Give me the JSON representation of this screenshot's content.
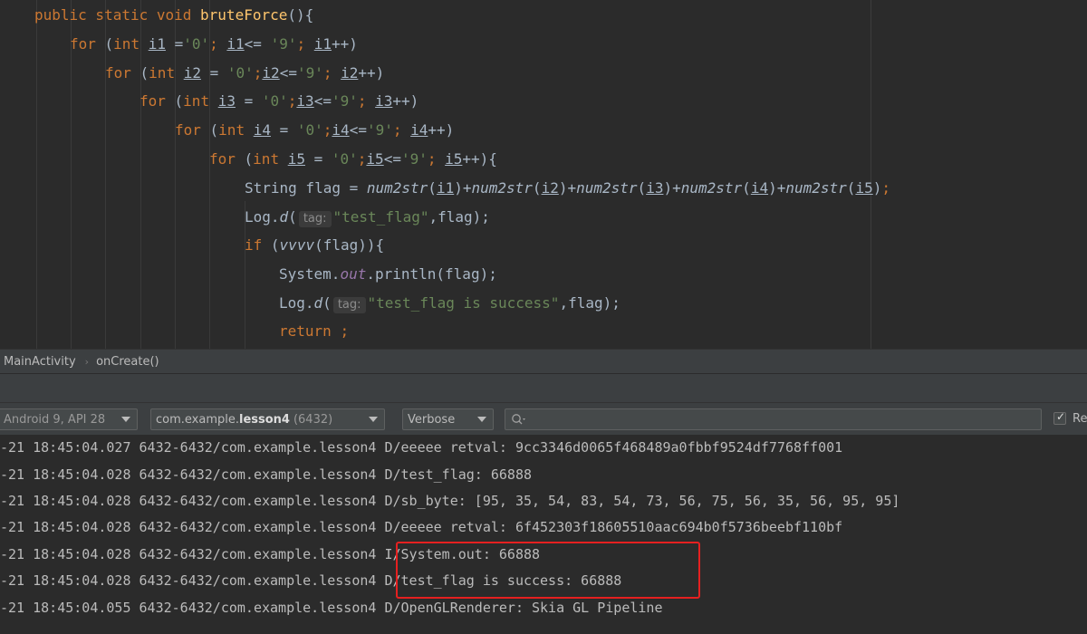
{
  "code": {
    "method_signature": {
      "mod": "public static void ",
      "name": "bruteForce",
      "rest": "(){"
    },
    "loop1": {
      "kw": "for ",
      "a": "(",
      "type": "int ",
      "var": "i1",
      "b": " =",
      "s1": "'0'",
      "c": "; ",
      "var2": "i1",
      "d": "<= ",
      "s2": "'9'",
      "e": "; ",
      "var3": "i1",
      "f": "++)"
    },
    "loop2": {
      "kw": "for ",
      "a": "(",
      "type": "int ",
      "var": "i2",
      "b": " = ",
      "s1": "'0'",
      "c": ";",
      "var2": "i2",
      "d": "<=",
      "s2": "'9'",
      "e": "; ",
      "var3": "i2",
      "f": "++)"
    },
    "loop3": {
      "kw": "for ",
      "a": "(",
      "type": "int ",
      "var": "i3",
      "b": " = ",
      "s1": "'0'",
      "c": ";",
      "var2": "i3",
      "d": "<=",
      "s2": "'9'",
      "e": "; ",
      "var3": "i3",
      "f": "++)"
    },
    "loop4": {
      "kw": "for ",
      "a": "(",
      "type": "int ",
      "var": "i4",
      "b": " = ",
      "s1": "'0'",
      "c": ";",
      "var2": "i4",
      "d": "<=",
      "s2": "'9'",
      "e": "; ",
      "var3": "i4",
      "f": "++)"
    },
    "loop5": {
      "kw": "for ",
      "a": "(",
      "type": "int ",
      "var": "i5",
      "b": " = ",
      "s1": "'0'",
      "c": ";",
      "var2": "i5",
      "d": "<=",
      "s2": "'9'",
      "e": "; ",
      "var3": "i5",
      "f": "++){"
    },
    "flag_line": {
      "type": "String flag = ",
      "fn": "num2str",
      "v1": "i1",
      "v2": "i2",
      "v3": "i3",
      "v4": "i4",
      "v5": "i5",
      "plus": "+",
      "open": "(",
      "close": ")",
      "semi": ";"
    },
    "logd1": {
      "obj": "Log.",
      "method": "d",
      "open": "(",
      "hint": "tag:",
      "str": "\"test_flag\"",
      "rest": ",flag);"
    },
    "if_line": {
      "kw": "if ",
      "open": "(",
      "fn": "vvvv",
      "rest": "(flag)){"
    },
    "println": {
      "obj": "System.",
      "field": "out",
      "rest": ".println(flag);"
    },
    "logd2": {
      "obj": "Log.",
      "method": "d",
      "open": "(",
      "hint": "tag:",
      "str": "\"test_flag is success\"",
      "rest": ",flag);"
    },
    "return_line": {
      "kw": "return ",
      "rest": ";"
    }
  },
  "breadcrumb": {
    "class_name": "MainActivity",
    "separator": "›",
    "method_name": "onCreate()"
  },
  "filters": {
    "device": "Android 9, API 28",
    "process_prefix": "com.example.",
    "process_bold": "lesson4",
    "process_pid": "(6432)",
    "log_level": "Verbose",
    "search_value": "",
    "regex_checked": true,
    "regex_label": "Re"
  },
  "logcat": {
    "lines": [
      "-21 18:45:04.027 6432-6432/com.example.lesson4 D/eeeee retval: 9cc3346d0065f468489a0fbbf9524df7768ff001",
      "-21 18:45:04.028 6432-6432/com.example.lesson4 D/test_flag: 66888",
      "-21 18:45:04.028 6432-6432/com.example.lesson4 D/sb_byte: [95, 35, 54, 83, 54, 73, 56, 75, 56, 35, 56, 95, 95]",
      "-21 18:45:04.028 6432-6432/com.example.lesson4 D/eeeee retval: 6f452303f18605510aac694b0f5736beebf110bf",
      "-21 18:45:04.028 6432-6432/com.example.lesson4 I/System.out: 66888",
      "-21 18:45:04.028 6432-6432/com.example.lesson4 D/test_flag is success: 66888",
      "-21 18:45:04.055 6432-6432/com.example.lesson4 D/OpenGLRenderer: Skia GL Pipeline"
    ]
  },
  "colors": {
    "keyword": "#cc7832",
    "string": "#6a8759",
    "field": "#9876aa",
    "highlight_box": "#e52020"
  }
}
